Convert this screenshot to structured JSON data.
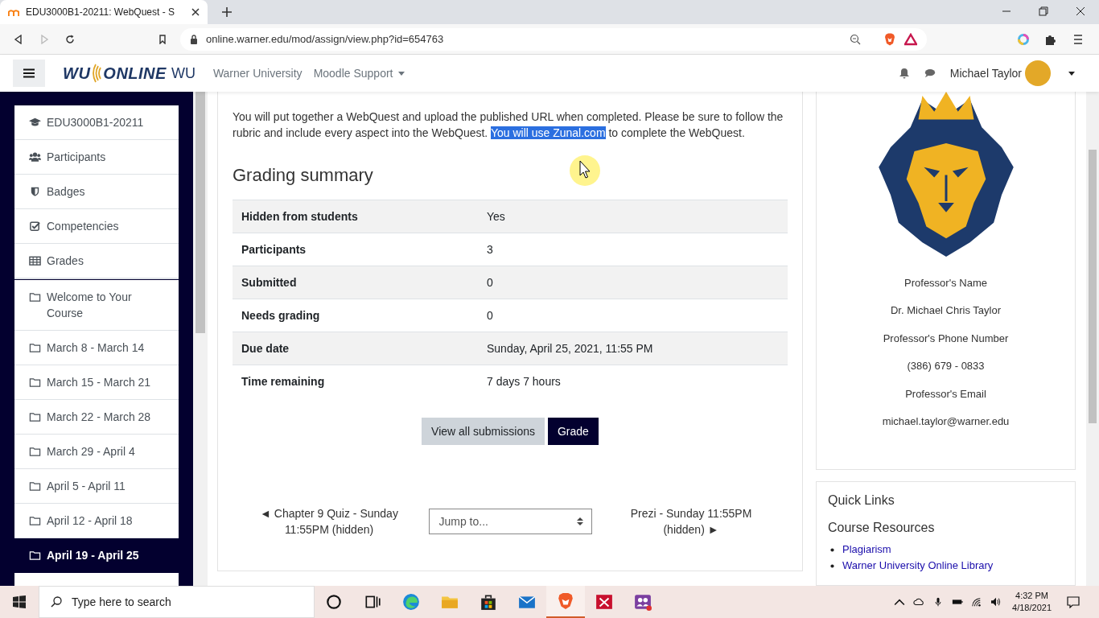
{
  "browser": {
    "tab_title": "EDU3000B1-20211: WebQuest - S",
    "url": "online.warner.edu/mod/assign/view.php?id=654763"
  },
  "navbar": {
    "logo_left": "WU",
    "logo_right": "ONLINE",
    "logo_suffix": "WU",
    "links": [
      {
        "label": "Warner University",
        "kind": "link"
      },
      {
        "label": "Moodle Support",
        "kind": "dropdown"
      }
    ],
    "user": "Michael Taylor"
  },
  "sidebar": {
    "items": [
      {
        "label": "EDU3000B1-20211",
        "kind": "course",
        "selected": false
      },
      {
        "label": "Participants",
        "kind": "participants",
        "selected": false
      },
      {
        "label": "Badges",
        "kind": "badges",
        "selected": false
      },
      {
        "label": "Competencies",
        "kind": "competencies",
        "selected": false
      },
      {
        "label": "Grades",
        "kind": "grades",
        "selected": false
      },
      {
        "label": "Welcome to Your Course",
        "kind": "section",
        "selected": false
      },
      {
        "label": "March 8 - March 14",
        "kind": "section",
        "selected": false
      },
      {
        "label": "March 15 - March 21",
        "kind": "section",
        "selected": false
      },
      {
        "label": "March 22 - March 28",
        "kind": "section",
        "selected": false
      },
      {
        "label": "March 29 - April 4",
        "kind": "section",
        "selected": false
      },
      {
        "label": "April 5 - April 11",
        "kind": "section",
        "selected": false
      },
      {
        "label": "April 12 - April 18",
        "kind": "section",
        "selected": false
      },
      {
        "label": "April 19 - April 25",
        "kind": "section",
        "selected": true
      }
    ]
  },
  "description": [
    {
      "text": "You will put together a WebQuest and upload the published URL when completed. Please be sure to follow the rubric and include every aspect into the WebQuest. ",
      "selected": false
    },
    {
      "text": "You will use Zunal.com",
      "selected": true
    },
    {
      "text": " to complete the WebQuest.",
      "selected": false
    }
  ],
  "grading_summary": {
    "title": "Grading summary",
    "rows": [
      {
        "label": "Hidden from students",
        "value": "Yes"
      },
      {
        "label": "Participants",
        "value": "3"
      },
      {
        "label": "Submitted",
        "value": "0"
      },
      {
        "label": "Needs grading",
        "value": "0"
      },
      {
        "label": "Due date",
        "value": "Sunday, April 25, 2021, 11:55 PM"
      },
      {
        "label": "Time remaining",
        "value": "7 days 7 hours"
      }
    ]
  },
  "buttons": [
    {
      "label": "View all submissions",
      "kind": "secondary"
    },
    {
      "label": "Grade",
      "kind": "primary"
    }
  ],
  "activity_nav": {
    "previous": "◄ Chapter 9 Quiz - Sunday 11:55PM (hidden)",
    "jump": {
      "placeholder": "Jump to..."
    },
    "next": "Prezi - Sunday 11:55PM (hidden) ►"
  },
  "instructor_block": {
    "lines": [
      "Professor's Name",
      "Dr. Michael Chris Taylor",
      "Professor's Phone Number",
      "(386) 679 - 0833",
      "Professor's Email",
      "michael.taylor@warner.edu"
    ]
  },
  "quick_links": {
    "title": "Quick Links",
    "subtitle": "Course Resources",
    "links": [
      "Plagiarism",
      "Warner University Online Library"
    ]
  },
  "taskbar": {
    "search": {
      "placeholder": "Type here to search"
    },
    "time": "4:32 PM",
    "date": "4/18/2021"
  }
}
